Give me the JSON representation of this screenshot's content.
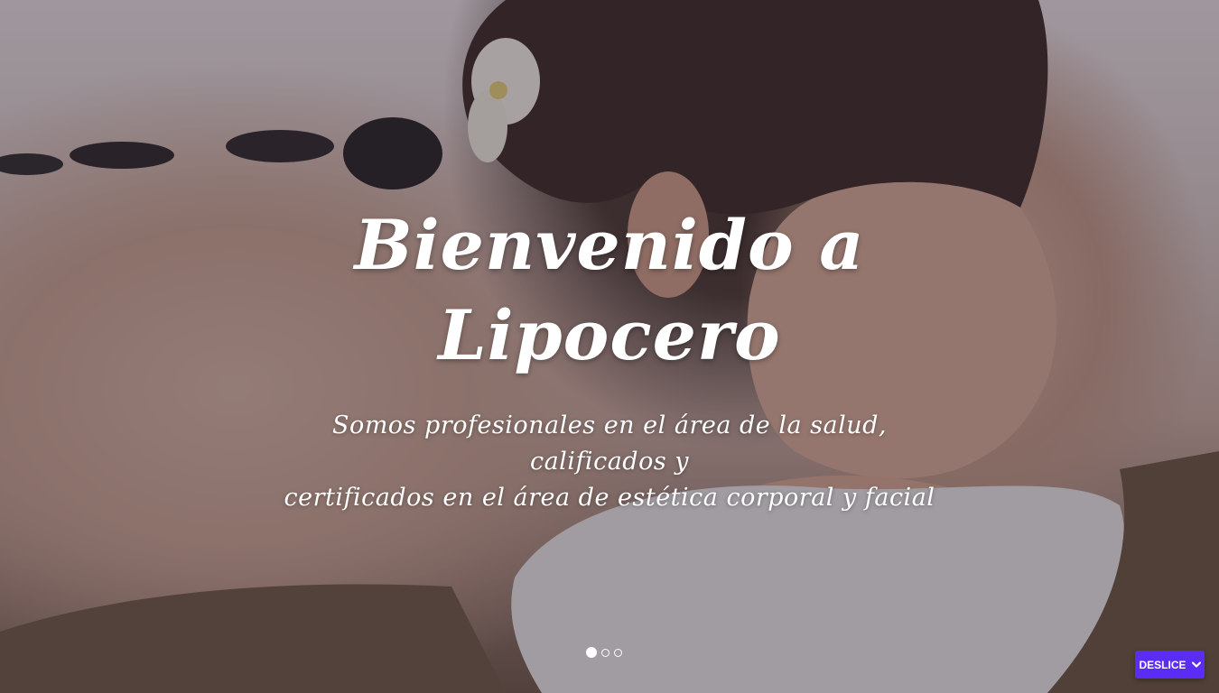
{
  "hero": {
    "title_line1": "Bienvenido a",
    "title_line2": "Lipocero",
    "subtitle_line1": "Somos profesionales en el área de la salud, calificados y",
    "subtitle_line2": "certificados en el área de estética corporal y facial",
    "image_icon": "spa-massage-photo"
  },
  "carousel": {
    "slide_count": 3,
    "active_index": 0
  },
  "scroll_button": {
    "label": "DESLICE",
    "icon": "chevron-down-icon"
  },
  "colors": {
    "accent": "#5a2cf4",
    "text": "#ffffff"
  }
}
